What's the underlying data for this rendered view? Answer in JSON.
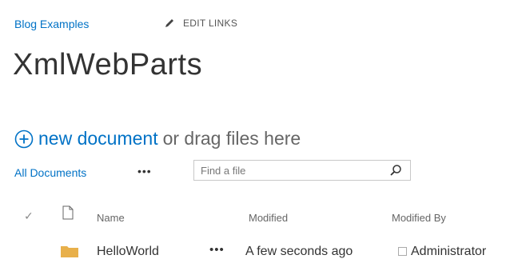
{
  "breadcrumb": {
    "label": "Blog Examples"
  },
  "edit_links": {
    "label": "EDIT LINKS"
  },
  "page": {
    "title": "XmlWebParts"
  },
  "new_document": {
    "link_label": "new document",
    "rest_label": "or drag files here"
  },
  "views": {
    "current": "All Documents",
    "more": "•••"
  },
  "search": {
    "placeholder": "Find a file"
  },
  "table": {
    "columns": [
      "Name",
      "Modified",
      "Modified By"
    ],
    "rows": [
      {
        "name": "HelloWorld",
        "menu": "•••",
        "modified": "A few seconds ago",
        "modified_by": "Administrator"
      }
    ]
  },
  "colors": {
    "accent": "#0072c6",
    "folder": "#e8b04b"
  },
  "icons": [
    "pencil-icon",
    "plus-circle-icon",
    "search-icon",
    "checkmark-icon",
    "document-type-icon",
    "folder-icon",
    "user-presence-icon"
  ]
}
